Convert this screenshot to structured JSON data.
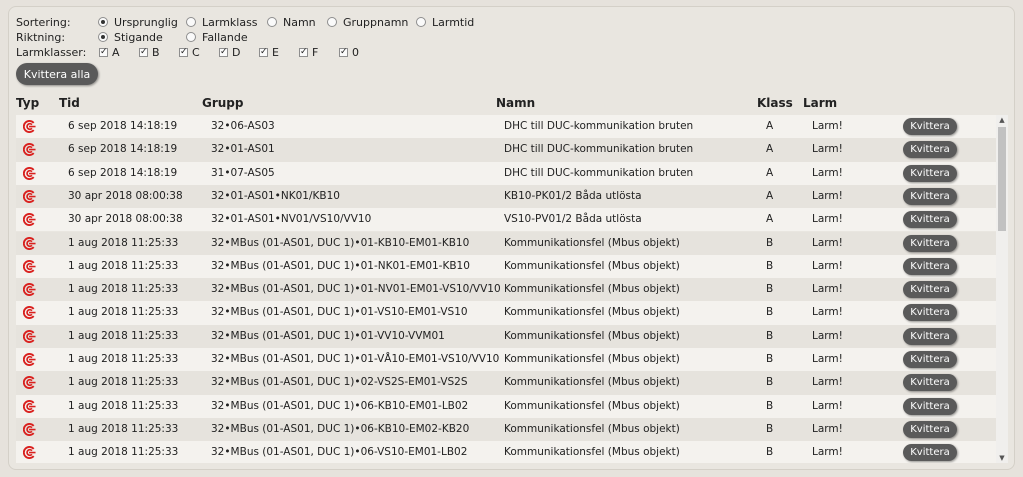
{
  "options": {
    "sort_label": "Sortering:",
    "sort_options": [
      "Ursprunglig",
      "Larmklass",
      "Namn",
      "Gruppnamn",
      "Larmtid"
    ],
    "sort_selected": 0,
    "dir_label": "Riktning:",
    "dir_options": [
      "Stigande",
      "Fallande"
    ],
    "dir_selected": 0,
    "class_label": "Larmklasser:",
    "classes": [
      "A",
      "B",
      "C",
      "D",
      "E",
      "F",
      "0"
    ]
  },
  "ack_all_label": "Kvittera alla",
  "table": {
    "headers": {
      "typ": "Typ",
      "tid": "Tid",
      "grupp": "Grupp",
      "namn": "Namn",
      "klass": "Klass",
      "larm": "Larm"
    },
    "ack_label": "Kvittera",
    "rows": [
      {
        "tid": "6 sep 2018 14:18:19",
        "grupp": "32•06-AS03",
        "namn": "DHC till DUC-kommunikation bruten",
        "klass": "A",
        "larm": "Larm!"
      },
      {
        "tid": "6 sep 2018 14:18:19",
        "grupp": "32•01-AS01",
        "namn": "DHC till DUC-kommunikation bruten",
        "klass": "A",
        "larm": "Larm!"
      },
      {
        "tid": "6 sep 2018 14:18:19",
        "grupp": "31•07-AS05",
        "namn": "DHC till DUC-kommunikation bruten",
        "klass": "A",
        "larm": "Larm!"
      },
      {
        "tid": "30 apr 2018 08:00:38",
        "grupp": "32•01-AS01•NK01/KB10",
        "namn": "KB10-PK01/2 Båda utlösta",
        "klass": "A",
        "larm": "Larm!"
      },
      {
        "tid": "30 apr 2018 08:00:38",
        "grupp": "32•01-AS01•NV01/VS10/VV10",
        "namn": "VS10-PV01/2 Båda utlösta",
        "klass": "A",
        "larm": "Larm!"
      },
      {
        "tid": "1 aug 2018 11:25:33",
        "grupp": "32•MBus (01-AS01, DUC 1)•01-KB10-EM01-KB10",
        "namn": "Kommunikationsfel (Mbus objekt)",
        "klass": "B",
        "larm": "Larm!"
      },
      {
        "tid": "1 aug 2018 11:25:33",
        "grupp": "32•MBus (01-AS01, DUC 1)•01-NK01-EM01-KB10",
        "namn": "Kommunikationsfel (Mbus objekt)",
        "klass": "B",
        "larm": "Larm!"
      },
      {
        "tid": "1 aug 2018 11:25:33",
        "grupp": "32•MBus (01-AS01, DUC 1)•01-NV01-EM01-VS10/VV10",
        "namn": "Kommunikationsfel (Mbus objekt)",
        "klass": "B",
        "larm": "Larm!"
      },
      {
        "tid": "1 aug 2018 11:25:33",
        "grupp": "32•MBus (01-AS01, DUC 1)•01-VS10-EM01-VS10",
        "namn": "Kommunikationsfel (Mbus objekt)",
        "klass": "B",
        "larm": "Larm!"
      },
      {
        "tid": "1 aug 2018 11:25:33",
        "grupp": "32•MBus (01-AS01, DUC 1)•01-VV10-VVM01",
        "namn": "Kommunikationsfel (Mbus objekt)",
        "klass": "B",
        "larm": "Larm!"
      },
      {
        "tid": "1 aug 2018 11:25:33",
        "grupp": "32•MBus (01-AS01, DUC 1)•01-VÅ10-EM01-VS10/VV10",
        "namn": "Kommunikationsfel (Mbus objekt)",
        "klass": "B",
        "larm": "Larm!"
      },
      {
        "tid": "1 aug 2018 11:25:33",
        "grupp": "32•MBus (01-AS01, DUC 1)•02-VS2S-EM01-VS2S",
        "namn": "Kommunikationsfel (Mbus objekt)",
        "klass": "B",
        "larm": "Larm!"
      },
      {
        "tid": "1 aug 2018 11:25:33",
        "grupp": "32•MBus (01-AS01, DUC 1)•06-KB10-EM01-LB02",
        "namn": "Kommunikationsfel (Mbus objekt)",
        "klass": "B",
        "larm": "Larm!"
      },
      {
        "tid": "1 aug 2018 11:25:33",
        "grupp": "32•MBus (01-AS01, DUC 1)•06-KB10-EM02-KB20",
        "namn": "Kommunikationsfel (Mbus objekt)",
        "klass": "B",
        "larm": "Larm!"
      },
      {
        "tid": "1 aug 2018 11:25:33",
        "grupp": "32•MBus (01-AS01, DUC 1)•06-VS10-EM01-LB02",
        "namn": "Kommunikationsfel (Mbus objekt)",
        "klass": "B",
        "larm": "Larm!"
      }
    ]
  },
  "colors": {
    "alarm_icon": "#d9201e",
    "button": "#5a5a5a"
  },
  "icons": {
    "alarm": "alarm-type-icon",
    "scroll_up": "scroll-up-arrow",
    "scroll_down": "scroll-down-arrow"
  }
}
